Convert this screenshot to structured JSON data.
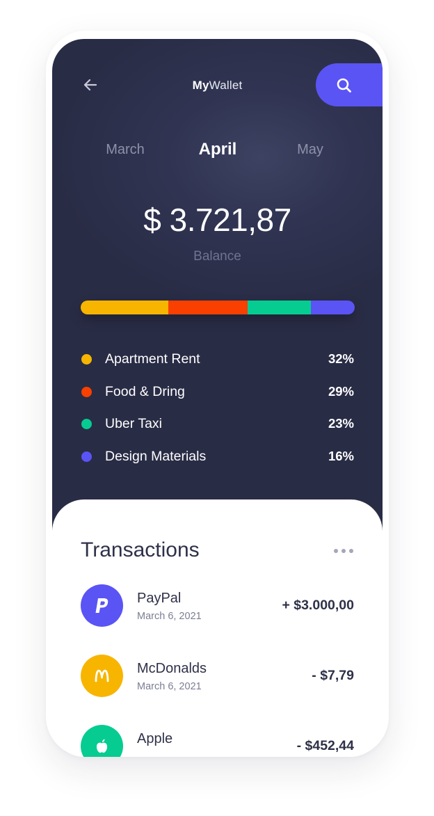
{
  "header": {
    "title_bold": "My",
    "title_rest": "Wallet"
  },
  "months": [
    "March",
    "April",
    "May"
  ],
  "balance": {
    "amount": "$ 3.721,87",
    "label": "Balance"
  },
  "categories": [
    {
      "name": "Apartment Rent",
      "percent": "32%",
      "share": 32,
      "color": "#f7b500"
    },
    {
      "name": "Food & Dring",
      "percent": "29%",
      "share": 29,
      "color": "#fa4000"
    },
    {
      "name": "Uber Taxi",
      "percent": "23%",
      "share": 23,
      "color": "#06cc91"
    },
    {
      "name": "Design Materials",
      "percent": "16%",
      "share": 16,
      "color": "#5a54f5"
    }
  ],
  "transactions": {
    "title": "Transactions",
    "items": [
      {
        "name": "PayPal",
        "date": "March 6, 2021",
        "amount": "+ $3.000,00",
        "icon": "paypal-icon",
        "color": "#5a54f5"
      },
      {
        "name": "McDonalds",
        "date": "March 6, 2021",
        "amount": "- $7,79",
        "icon": "mcdonalds-icon",
        "color": "#f7b500"
      },
      {
        "name": "Apple",
        "date": "",
        "amount": "- $452,44",
        "icon": "apple-icon",
        "color": "#06cc91"
      }
    ]
  },
  "colors": {
    "accent": "#5a54f5",
    "dark_bg": "#2c2f4a"
  }
}
